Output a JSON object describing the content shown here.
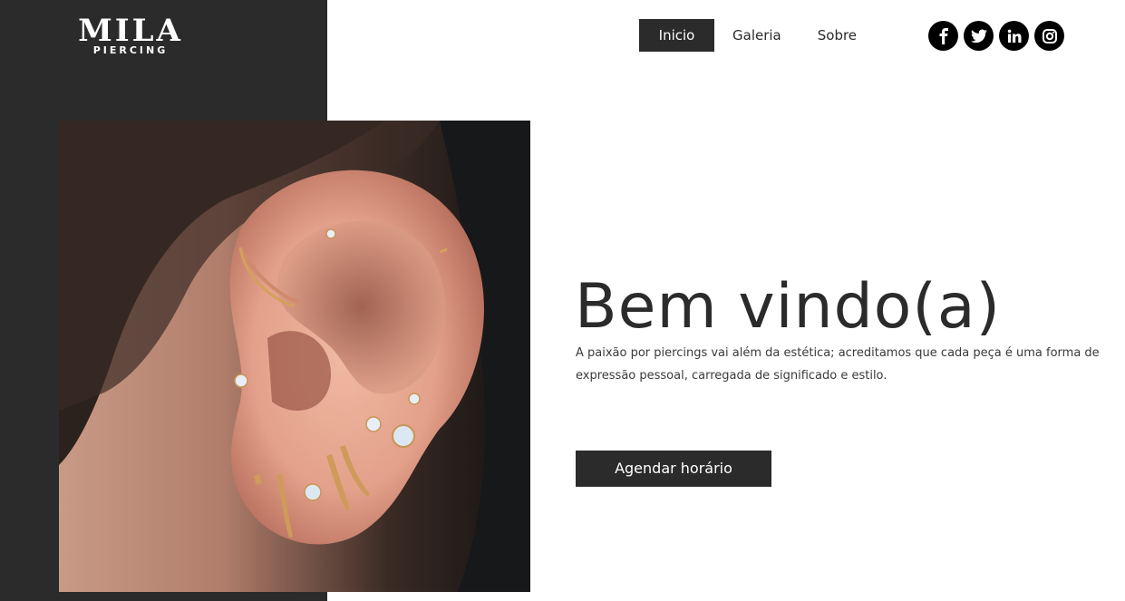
{
  "brand": {
    "name": "MILA",
    "tagline": "PIERCING"
  },
  "nav": {
    "items": [
      {
        "label": "Inicio",
        "active": true
      },
      {
        "label": "Galeria",
        "active": false
      },
      {
        "label": "Sobre",
        "active": false
      }
    ]
  },
  "social": {
    "icons": [
      "facebook-icon",
      "twitter-icon",
      "linkedin-icon",
      "instagram-icon"
    ]
  },
  "hero": {
    "title": "Bem vindo(a)",
    "text": "A paixão por piercings vai além da estética; acreditamos que cada peça é uma forma de expressão pessoal, carregada de significado e estilo.",
    "cta_label": "Agendar horário"
  },
  "colors": {
    "dark": "#2b2b2b",
    "background": "#ffffff",
    "social_bg": "#000000"
  }
}
